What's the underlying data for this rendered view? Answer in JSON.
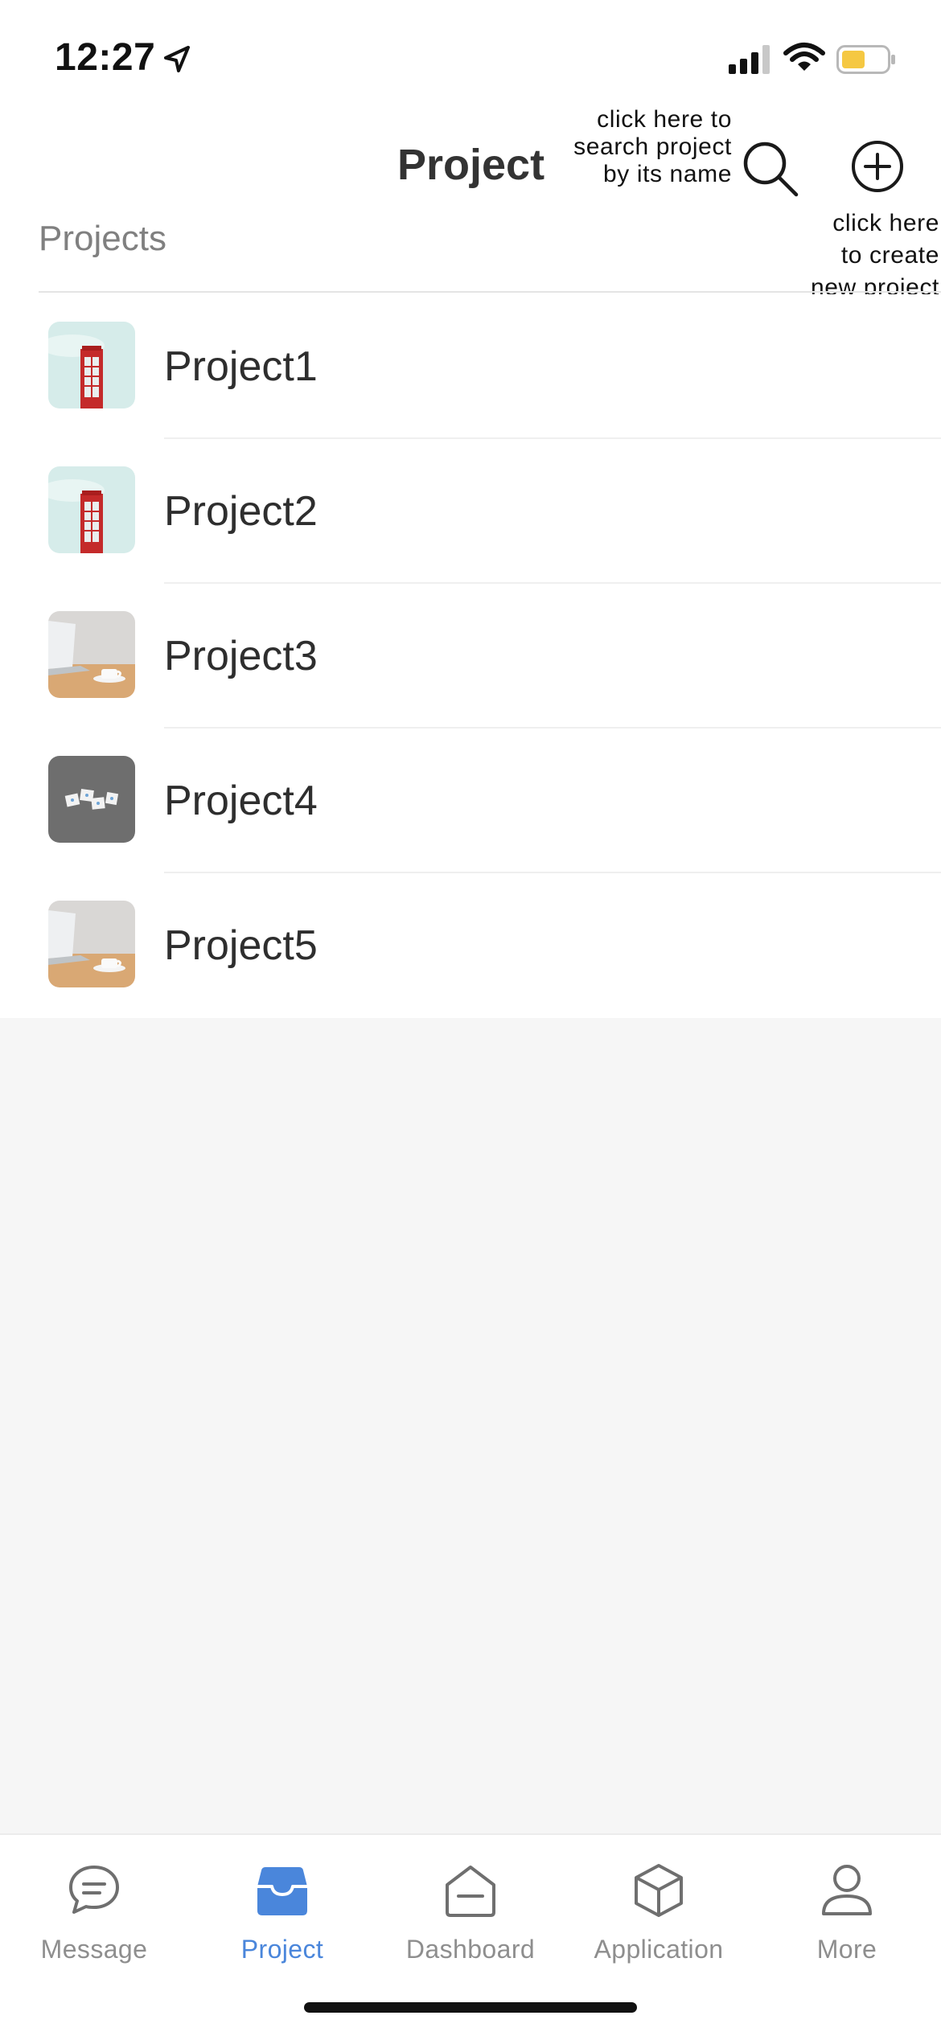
{
  "status_bar": {
    "time": "12:27",
    "icons": [
      "location-arrow-icon",
      "cellular-signal-icon",
      "wifi-icon",
      "battery-icon"
    ],
    "battery_color": "#f5c842"
  },
  "header": {
    "title": "Project",
    "search_hint": "click here to search project by its name",
    "search_hint_lines": [
      "click here to",
      "search project",
      "by its name"
    ],
    "add_hint": "click here to create new project",
    "add_hint_lines": [
      "click here",
      "to create",
      "new project"
    ],
    "section_label": "Projects"
  },
  "projects": [
    {
      "name": "Project1",
      "thumbnail": "red-phone-booth"
    },
    {
      "name": "Project2",
      "thumbnail": "red-phone-booth"
    },
    {
      "name": "Project3",
      "thumbnail": "laptop-coffee-desk"
    },
    {
      "name": "Project4",
      "thumbnail": "scattered-cards-gray"
    },
    {
      "name": "Project5",
      "thumbnail": "laptop-coffee-desk"
    }
  ],
  "tab_bar": {
    "accent_color": "#4a86db",
    "tabs": [
      {
        "label": "Message",
        "icon": "chat-bubble-icon",
        "active": false
      },
      {
        "label": "Project",
        "icon": "inbox-tray-icon",
        "active": true
      },
      {
        "label": "Dashboard",
        "icon": "dashboard-icon",
        "active": false
      },
      {
        "label": "Application",
        "icon": "cube-icon",
        "active": false
      },
      {
        "label": "More",
        "icon": "user-icon",
        "active": false
      }
    ]
  }
}
